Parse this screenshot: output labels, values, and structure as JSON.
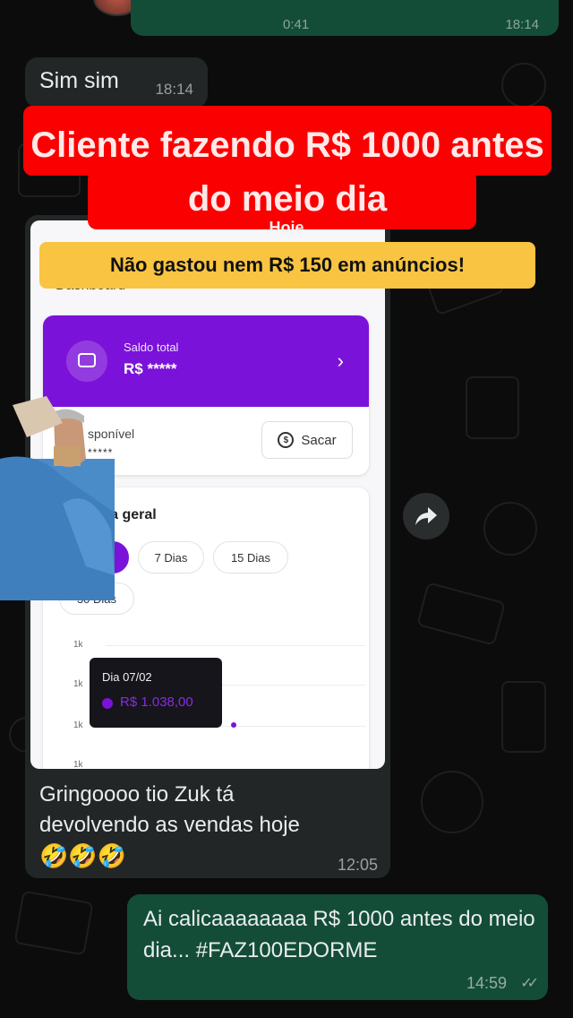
{
  "top_message": {
    "time_partial": "0:41",
    "time_partial_right": "18:14"
  },
  "messages": {
    "incoming_short": {
      "text": "Sim sim",
      "time": "18:14"
    },
    "image_caption": {
      "text_line1": "Gringoooo tio Zuk tá",
      "text_line2": "devolvendo as vendas hoje",
      "emojis": "🤣🤣🤣",
      "time": "12:05"
    },
    "outgoing": {
      "text": "Ai calicaaaaaaaa R$ 1000 antes do meio dia... #FAZ100EDORME",
      "time": "14:59",
      "ticks": "✓✓"
    }
  },
  "overlay": {
    "red_headline": "Cliente fazendo R$ 1000 antes do meio dia",
    "yellow_subtitle": "Não gastou nem R$ 150 em anúncios!"
  },
  "screenshot": {
    "day_label": "Hoje",
    "page_title": "Dashboard",
    "balance": {
      "label": "Saldo total",
      "value": "R$ *****",
      "chevron": "›"
    },
    "available": {
      "label": "sponível",
      "value": "*****"
    },
    "withdraw_button": "Sacar",
    "withdraw_icon": "$",
    "overview": {
      "title": "ama geral",
      "chips": [
        "oje",
        "7 Dias",
        "15 Dias",
        "30 Dias"
      ],
      "y_ticks": [
        "1k",
        "1k",
        "1k",
        "1k"
      ],
      "tooltip_day": "Dia 07/02",
      "tooltip_value": "R$ 1.038,00"
    },
    "accent_color": "#7b12d9"
  },
  "icons": {
    "forward": "forward-arrow-icon"
  }
}
